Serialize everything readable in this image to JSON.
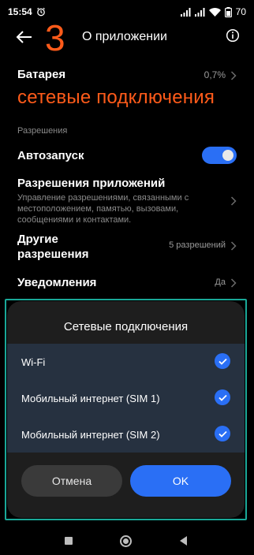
{
  "status_bar": {
    "time": "15:54",
    "battery_percent": "70"
  },
  "header": {
    "step_annotation": "3",
    "title": "О приложении"
  },
  "battery": {
    "label": "Батарея",
    "value": "0,7%"
  },
  "annotation_overlay": "сетевые подключения",
  "permissions": {
    "section_title": "Разрешения",
    "autostart": {
      "label": "Автозапуск",
      "enabled": true
    },
    "app_permissions": {
      "label": "Разрешения приложений",
      "description": "Управление разрешениями, связанными с местоположением, памятью, вызовами, сообщениями и контактами."
    },
    "other_permissions": {
      "label": "Другие разрешения",
      "value": "5 разрешений"
    },
    "notifications": {
      "label": "Уведомления",
      "value": "Да"
    }
  },
  "dialog": {
    "title": "Сетевые подключения",
    "options": [
      {
        "label": "Wi-Fi",
        "checked": true
      },
      {
        "label": "Мобильный интернет (SIM 1)",
        "checked": true
      },
      {
        "label": "Мобильный интернет (SIM 2)",
        "checked": true
      }
    ],
    "cancel_label": "Отмена",
    "ok_label": "OK"
  },
  "colors": {
    "accent": "#2a6ff5",
    "annotation": "#ff5b1a",
    "frame": "#1aa898"
  }
}
